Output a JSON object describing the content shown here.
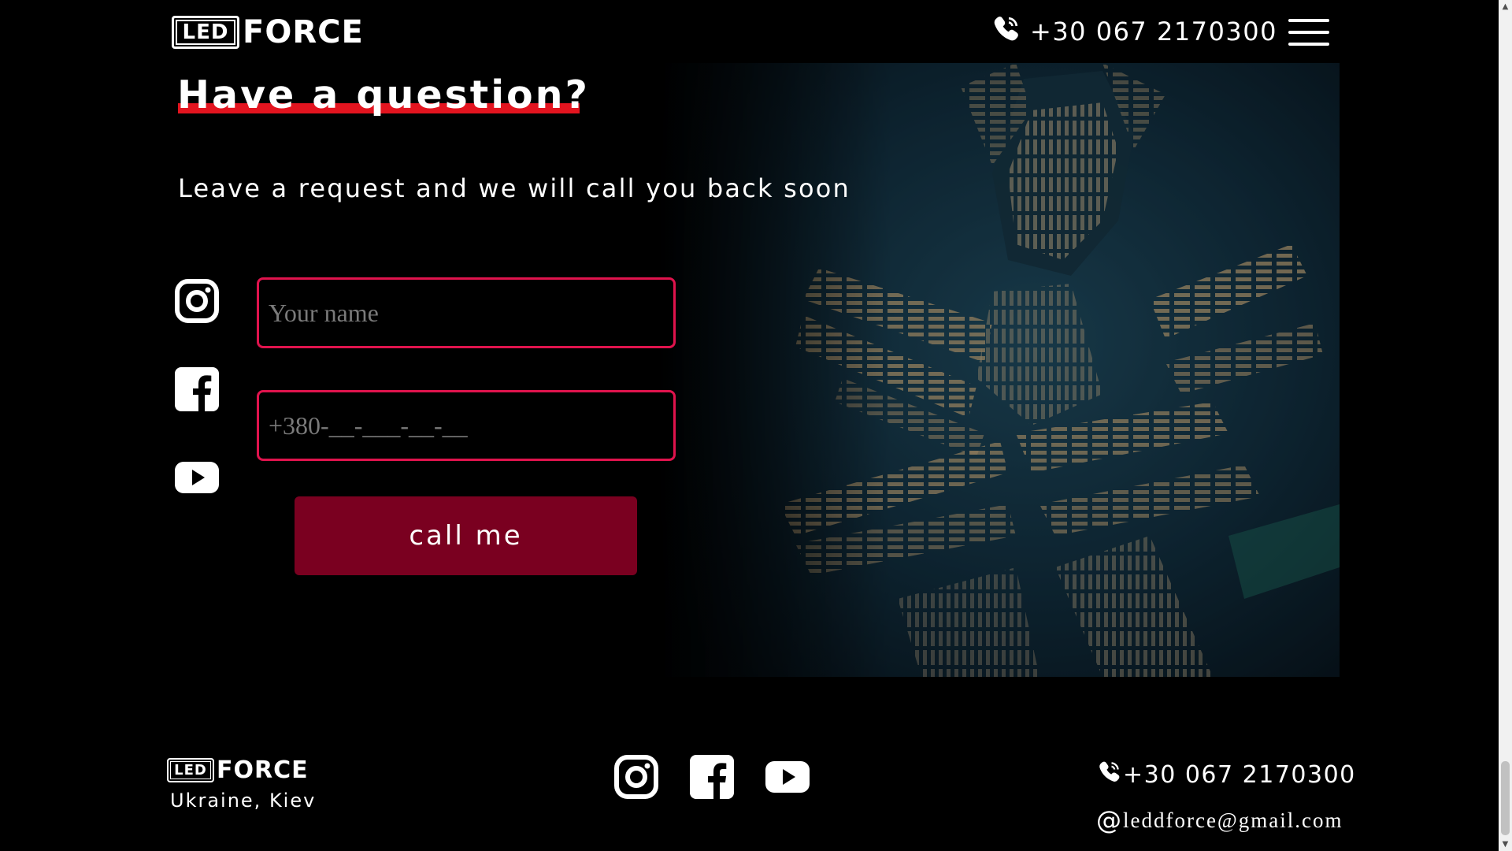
{
  "header": {
    "logo": {
      "box_text": "LED",
      "word_text": "FORCE"
    },
    "phone": "+30 067 2170300",
    "menu_icon": "hamburger-menu-icon"
  },
  "hero": {
    "title": "Have a question?",
    "subtitle": "Leave a request and we will call you back soon",
    "accent_color": "#e3141f",
    "social_icons": [
      "instagram-icon",
      "facebook-icon",
      "youtube-icon"
    ],
    "form": {
      "name_placeholder": "Your name",
      "phone_placeholder": "+380-__-___-__-__",
      "submit_label": "call me"
    }
  },
  "footer": {
    "logo": {
      "box_text": "LED",
      "word_text": "FORCE"
    },
    "location": "Ukraine, Kiev",
    "social_icons": [
      "instagram-icon",
      "facebook-icon",
      "youtube-icon"
    ],
    "phone": "+30 067 2170300",
    "email": "leddforce@gmail.com"
  },
  "colors": {
    "background": "#000000",
    "field_border": "#e0134d",
    "button": "#7a0020"
  }
}
